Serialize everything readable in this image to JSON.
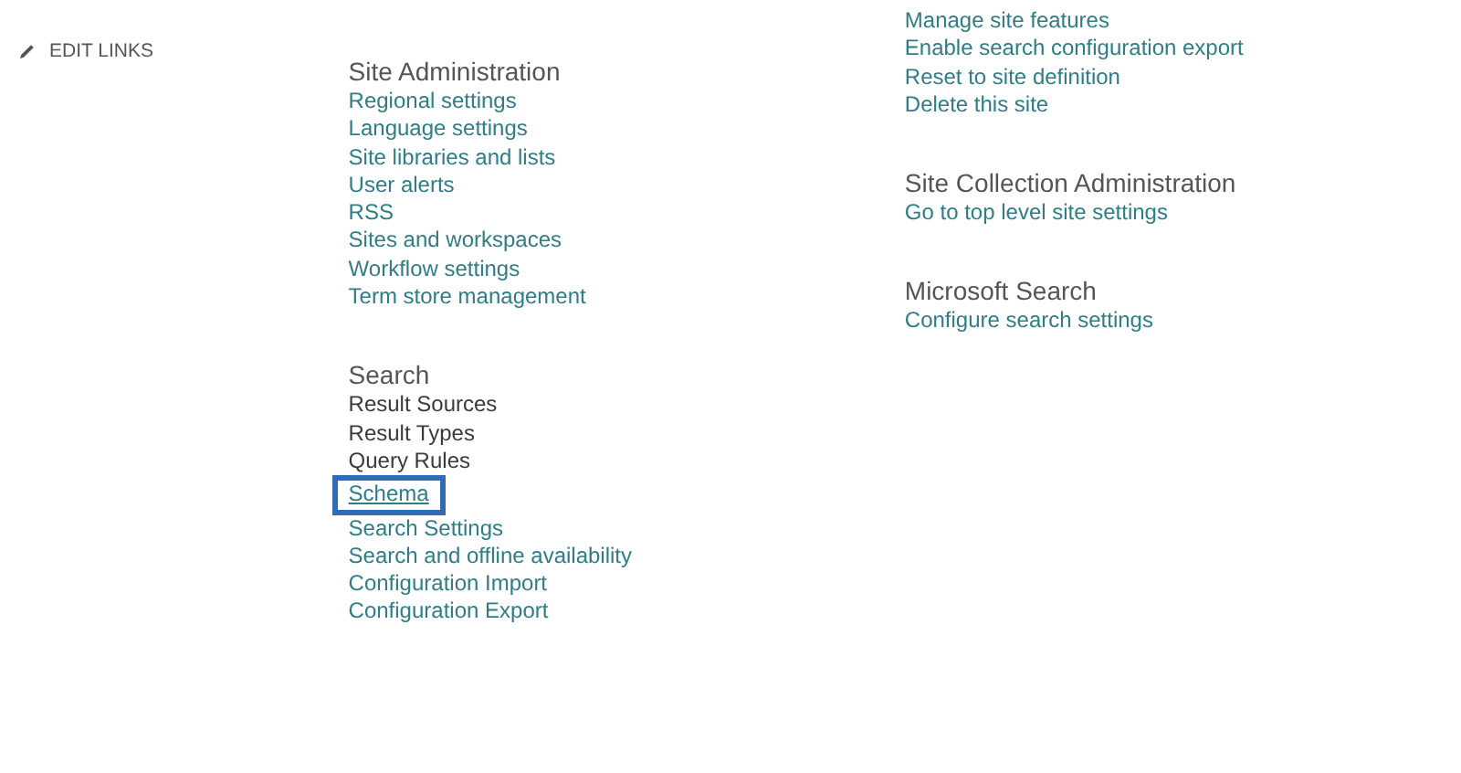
{
  "left_nav": {
    "edit_links": "EDIT LINKS"
  },
  "columns": [
    {
      "sections": [
        {
          "heading": "Site Administration",
          "links": [
            {
              "label": "Regional settings",
              "visited": false,
              "highlighted": false
            },
            {
              "label": "Language settings",
              "visited": false,
              "highlighted": false
            },
            {
              "label": "Site libraries and lists",
              "visited": false,
              "highlighted": false
            },
            {
              "label": "User alerts",
              "visited": false,
              "highlighted": false
            },
            {
              "label": "RSS",
              "visited": false,
              "highlighted": false
            },
            {
              "label": "Sites and workspaces",
              "visited": false,
              "highlighted": false
            },
            {
              "label": "Workflow settings",
              "visited": false,
              "highlighted": false
            },
            {
              "label": "Term store management",
              "visited": false,
              "highlighted": false
            }
          ]
        },
        {
          "heading": "Search",
          "links": [
            {
              "label": "Result Sources",
              "visited": true,
              "highlighted": false
            },
            {
              "label": "Result Types",
              "visited": true,
              "highlighted": false
            },
            {
              "label": "Query Rules",
              "visited": true,
              "highlighted": false
            },
            {
              "label": "Schema",
              "visited": false,
              "highlighted": true
            },
            {
              "label": "Search Settings",
              "visited": false,
              "highlighted": false
            },
            {
              "label": "Search and offline availability",
              "visited": false,
              "highlighted": false
            },
            {
              "label": "Configuration Import",
              "visited": false,
              "highlighted": false
            },
            {
              "label": "Configuration Export",
              "visited": false,
              "highlighted": false
            }
          ]
        }
      ]
    },
    {
      "sections": [
        {
          "links": [
            {
              "label": "Manage site features",
              "visited": false,
              "highlighted": false
            },
            {
              "label": "Enable search configuration export",
              "visited": false,
              "highlighted": false
            },
            {
              "label": "Reset to site definition",
              "visited": false,
              "highlighted": false
            },
            {
              "label": "Delete this site",
              "visited": false,
              "highlighted": false
            }
          ]
        },
        {
          "heading": "Site Collection Administration",
          "links": [
            {
              "label": "Go to top level site settings",
              "visited": false,
              "highlighted": false
            }
          ]
        },
        {
          "heading": "Microsoft Search",
          "links": [
            {
              "label": "Configure search settings",
              "visited": false,
              "highlighted": false
            }
          ]
        }
      ]
    }
  ]
}
